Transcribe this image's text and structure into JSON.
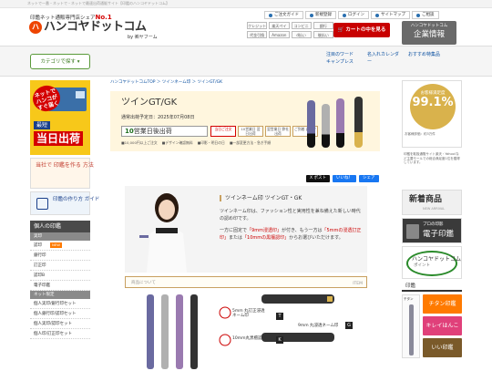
{
  "topbar": {
    "text": "ネットで一番・ネットで・ネットで最速出荷通販サイト【印鑑のハンコヤドットコム】"
  },
  "header": {
    "tagline_prefix": "印鑑ネット通販専門店シェア",
    "tagline_no1": "No.1",
    "logo_mark": "ハ",
    "logo_text": "ハンコヤドットコム",
    "logo_by": "by ㈱ヤフーム",
    "util_links": [
      {
        "label": "ご注文ガイド",
        "icon": "guide-icon",
        "color": "#2a6fb0"
      },
      {
        "label": "新規登録",
        "icon": "person-icon",
        "color": "#2a6fb0"
      },
      {
        "label": "ログイン",
        "icon": "key-icon",
        "color": "#2a6fb0"
      },
      {
        "label": "サイトマップ",
        "icon": "map-icon",
        "color": "#2a6fb0"
      },
      {
        "label": "ご相談",
        "icon": "mail-icon",
        "color": "#2a6fb0"
      }
    ],
    "payments_row1": [
      "クレジット",
      "楽天ペイ",
      "コンビニ",
      "銀行"
    ],
    "payments_row2": [
      "代金引換",
      "Amazon",
      "d払い",
      "後払い"
    ],
    "cart_label": "カートの中を見る",
    "corp_small": "ハンコヤドットコム",
    "corp_large": "企業情報"
  },
  "gnav": {
    "category_button": "カテゴリで探す",
    "hotwords": [
      "注目のワード キャンプレス",
      "名入れカレンダー",
      "おすすめ特集品"
    ]
  },
  "sidebar": {
    "ship_bubble": "ネットで ハンコが すぐ届く",
    "ship_small": "最短",
    "ship_big": "当日出荷",
    "design_banner": "当社で 印鑑を作る 方法",
    "guide_banner": "印鑑の作り方 ガイド",
    "heading": "個人の印鑑",
    "sub1": "実印",
    "items": [
      "認印",
      "銀行印",
      "訂正印",
      "認印B",
      "電子印鑑"
    ],
    "new_badge": "NEW",
    "sub2": "ネット限定",
    "items2": [
      "個人実印/銀行印セット",
      "個人銀行印/認印セット",
      "個人実印/認印セット",
      "個人印/訂正印セット"
    ]
  },
  "main": {
    "breadcrumb": "ハンコヤドットコムTOP ＞ ツインネーム印 ＞ ツインGT/GK",
    "hero_title": "ツインGT/GK",
    "hero_date": "通常出荷予定日：2025年07月08日",
    "hero_days_num": "10",
    "hero_days_text": "営業日後出荷",
    "hero_icons": [
      {
        "label": "当日ご注文",
        "active": true
      },
      {
        "label": "10営業日 翌日出荷",
        "active": false
      },
      {
        "label": "翌営業日 弊社出荷",
        "active": false
      },
      {
        "label": "ご到着 お届け",
        "active": false
      }
    ],
    "hero_notes": [
      "10,000円以上ご注文",
      "デザイン確認無料",
      "印影・明日の日",
      "一部変更方法・急ぎ手順"
    ],
    "share_buttons": [
      {
        "label": "X ポスト",
        "color": "#111111"
      },
      {
        "label": "いいね！",
        "color": "#1877f2"
      },
      {
        "label": "シェア",
        "color": "#1877f2"
      }
    ],
    "intro_title": "ツインネーム印 ツインGT・GK",
    "intro_body_1": "ツインネーム印は、ファッション性と実用性を兼ね備えた新しい時代の認め印です。",
    "intro_body_2a": "一方に固定で",
    "intro_body_2r1": "「9mm浸透印」",
    "intro_body_2b": "が付き、もう一方は",
    "intro_body_2r2": "「5mmの浸透訂正印」",
    "intro_body_2c": "または",
    "intro_body_2r3": "「10mmの黒檀認印」",
    "intro_body_2d": "からお選びいただけます。",
    "about_title": "商品について",
    "about_item": "ITEM",
    "product_labels": [
      "5mm 丸訂正浸透ネーム印",
      "9mm 丸浸透ネーム印",
      "10mm丸黒檀認印"
    ],
    "product_marks": [
      "T",
      "G",
      "K"
    ],
    "pen_colors": [
      "#6a6aa0",
      "#b0b0b0",
      "#9a7ab0",
      "#333333"
    ]
  },
  "rightcol": {
    "award_small": "お客様満足度",
    "award_big": "99.1%",
    "award_note": "お客様評価：約3万件",
    "text": "印鑑を取扱通販サイト楽天・Yahoo!など主要モールでの総合満足度1位を獲得しています。",
    "new_title": "新着商品",
    "new_sub": "NEW ARRIVAL",
    "pro_small": "プロの印影",
    "pro_big": "電子印鑑",
    "hc_title": "ハンコヤドットコム",
    "hc_sub": "ポイント",
    "ins_head": "印鑑",
    "ins_cols": [
      "チタン",
      "黒水牛",
      "柘"
    ],
    "ins_colors": [
      "#8a8a9a",
      "#222222",
      "#d9b070"
    ],
    "ins_banners": [
      {
        "label": "チタン印鑑",
        "color": "#ff7a00"
      },
      {
        "label": "キレイはんこ",
        "color": "#e0407a"
      },
      {
        "label": "いい印鑑",
        "color": "#7a5a2a"
      }
    ]
  }
}
